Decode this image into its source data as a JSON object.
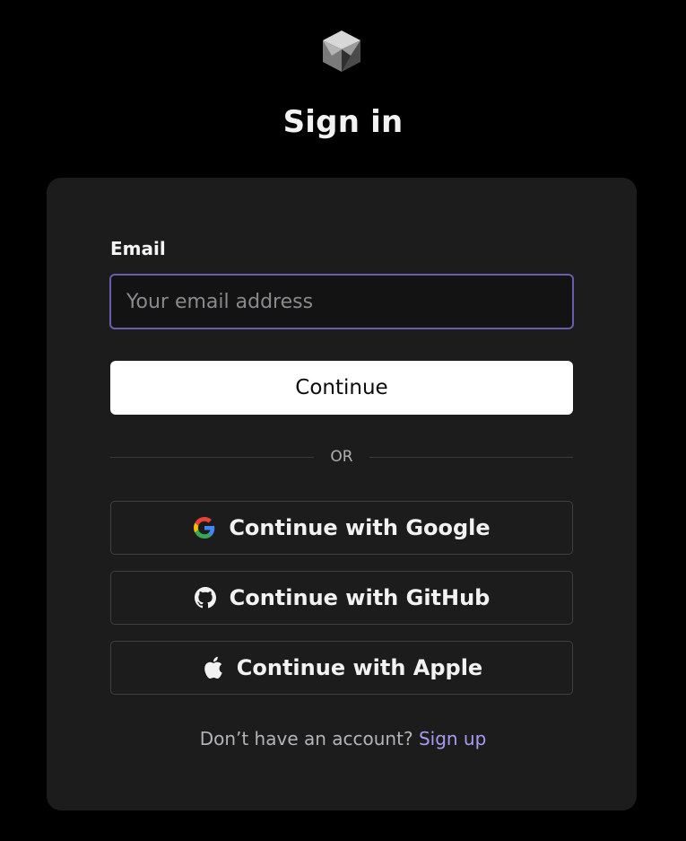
{
  "header": {
    "logo_icon": "cube-logo-icon",
    "title": "Sign in"
  },
  "form": {
    "email_label": "Email",
    "email_placeholder": "Your email address",
    "email_value": "",
    "continue_label": "Continue",
    "divider_text": "OR",
    "accent_color": "#6a5dad"
  },
  "oauth": [
    {
      "label": "Continue with Google",
      "icon": "google-icon"
    },
    {
      "label": "Continue with GitHub",
      "icon": "github-icon"
    },
    {
      "label": "Continue with Apple",
      "icon": "apple-icon"
    }
  ],
  "footer": {
    "prompt": "Don’t have an account?",
    "link_label": "Sign up",
    "link_color": "#a99cf0"
  }
}
